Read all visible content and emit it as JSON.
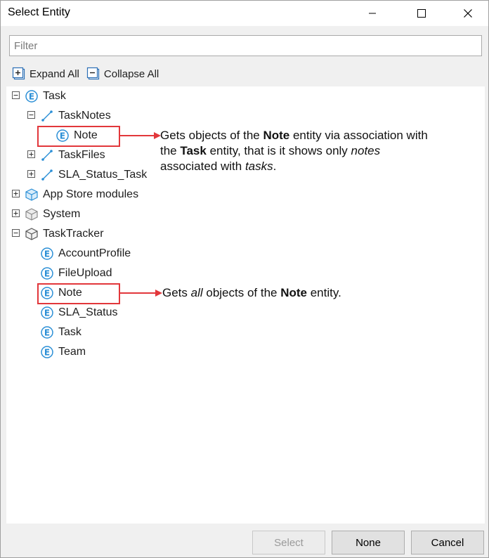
{
  "window": {
    "title": "Select Entity"
  },
  "filter": {
    "placeholder": "Filter",
    "value": ""
  },
  "toolbar": {
    "expand_all": "Expand All",
    "collapse_all": "Collapse All"
  },
  "tree": {
    "task": "Task",
    "task_notes": "TaskNotes",
    "note_assoc": "Note",
    "task_files": "TaskFiles",
    "sla_status_task": "SLA_Status_Task",
    "app_store": "App Store modules",
    "system": "System",
    "task_tracker": "TaskTracker",
    "account_profile": "AccountProfile",
    "file_upload": "FileUpload",
    "note": "Note",
    "sla_status": "SLA_Status",
    "task2": "Task",
    "team": "Team"
  },
  "annotations": {
    "first": {
      "p1": "Gets objects of the ",
      "b1": "Note",
      "p2": " entity via association with",
      "p3": "the ",
      "b2": "Task",
      "p4": " entity, that is it shows only ",
      "i1": "notes",
      "p5": "associated with ",
      "i2": "tasks",
      "p6": "."
    },
    "second": {
      "p1": "Gets ",
      "i1": "all",
      "p2": " objects of the ",
      "b1": "Note",
      "p3": " entity."
    }
  },
  "footer": {
    "select": "Select",
    "none": "None",
    "cancel": "Cancel"
  },
  "colors": {
    "highlight": "#e2373b",
    "entity_icon": "#2b8fd6",
    "association_icon": "#2b8fd6"
  }
}
